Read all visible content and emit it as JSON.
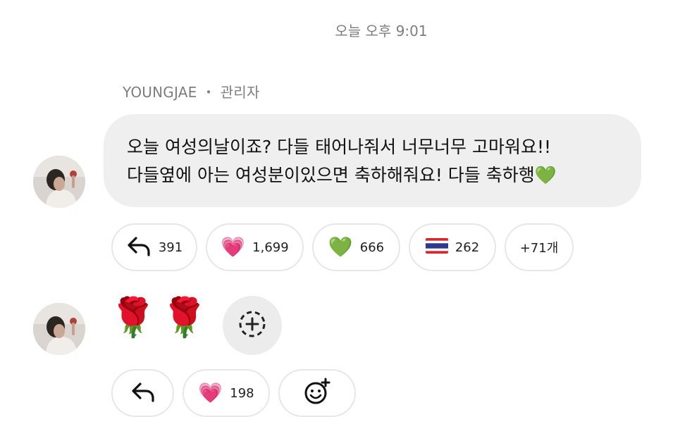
{
  "timestamp": "오늘 오후 9:01",
  "message1": {
    "sender": "YOUNGJAE",
    "role": "관리자",
    "separator": "・",
    "lines": [
      "오늘 여성의날이죠? 다들 태어나줘서 너무너무 고마워요!!",
      "다들옆에 아는 여성분이있으면 축하해줘요! 다들 축하행💚"
    ],
    "reactions": [
      {
        "icon": "reply-arrow-icon",
        "count": "391"
      },
      {
        "icon": "pink-heart-emoji",
        "emoji": "💗",
        "count": "1,699"
      },
      {
        "icon": "green-heart-emoji",
        "emoji": "💚",
        "count": "666"
      },
      {
        "icon": "thailand-flag-emoji",
        "emoji": "🇹🇭",
        "count": "262"
      }
    ],
    "more_reactions": "+71개"
  },
  "message2": {
    "emojis": [
      "🌹",
      "🌹"
    ],
    "add_icon": "add-reaction-icon",
    "reactions": [
      {
        "icon": "reply-arrow-icon"
      },
      {
        "icon": "pink-heart-emoji",
        "emoji": "💗",
        "count": "198"
      },
      {
        "icon": "add-emoji-icon"
      }
    ]
  },
  "colors": {
    "bubble": "#efefef",
    "muted_text": "#7d7d7d",
    "chip_border": "#e7e7e7",
    "add_button_bg": "#ececec"
  }
}
